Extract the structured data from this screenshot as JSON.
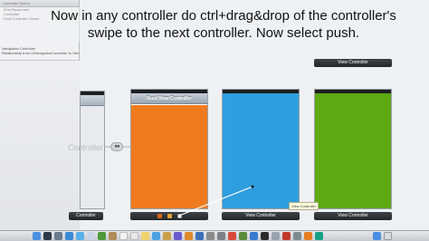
{
  "outline": {
    "header": "Controller Scene",
    "rows": [
      "First Responder",
      "Controller",
      "Root Controller Scene"
    ],
    "nav_controller": "Navigation Controller",
    "relationship": "Relationship from UINavigationController to View Controller"
  },
  "instruction": "Now in any controller do ctrl+drag&drop of the controller's swipe to the next controller. Now select push.",
  "scenes": {
    "nav_partial_title": "Controller",
    "nav_partial_label": "Controller",
    "root_nav_title": "Root View Controller",
    "blue_label": "View Controller",
    "green_label": "View Controller",
    "top_label": "View Controller",
    "tooltip": "View Controller"
  },
  "colors": {
    "orange": "#f07b1f",
    "blue": "#2f9ede",
    "green": "#5ea814"
  }
}
